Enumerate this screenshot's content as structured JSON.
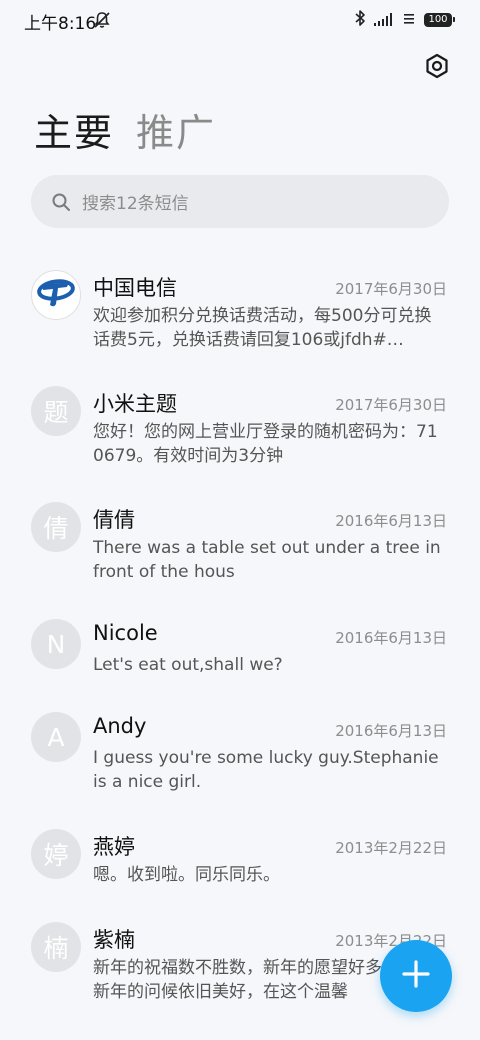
{
  "status_bar": {
    "time": "上午8:16",
    "battery": "100",
    "icons": [
      "mute-icon",
      "bluetooth-icon",
      "signal-icon",
      "wifi-icon",
      "battery-icon"
    ]
  },
  "header": {
    "settings_icon": "settings-hexagon-icon",
    "tabs": [
      {
        "label": "主要",
        "active": true
      },
      {
        "label": "推广",
        "active": false
      }
    ]
  },
  "search": {
    "placeholder": "搜索12条短信"
  },
  "messages": [
    {
      "name": "中国电信",
      "date": "2017年6月30日",
      "preview": "欢迎参加积分兑换话费活动，每500分可兑换话费5元，兑换话费请回复106或jfdh#…",
      "avatar": "",
      "avatar_type": "china-telecom-logo"
    },
    {
      "name": "小米主题",
      "date": "2017年6月30日",
      "preview": "您好！您的网上营业厅登录的随机密码为：710679。有效时间为3分钟",
      "avatar": "题",
      "avatar_type": "letter"
    },
    {
      "name": "倩倩",
      "date": "2016年6月13日",
      "preview": "There was a table set out under a tree in front of the hous",
      "avatar": "倩",
      "avatar_type": "letter"
    },
    {
      "name": "Nicole",
      "date": "2016年6月13日",
      "preview": "Let's eat out,shall we?",
      "avatar": "N",
      "avatar_type": "letter"
    },
    {
      "name": "Andy",
      "date": "2016年6月13日",
      "preview": "I guess you're some lucky guy.Stephanie is a nice girl.",
      "avatar": "A",
      "avatar_type": "letter"
    },
    {
      "name": "燕婷",
      "date": "2013年2月22日",
      "preview": "嗯。收到啦。同乐同乐。",
      "avatar": "婷",
      "avatar_type": "letter"
    },
    {
      "name": "紫楠",
      "date": "2013年2月22日",
      "preview": "新年的祝福数不胜数，新年的愿望好多好多，新年的问候依旧美好，在这个温馨",
      "avatar": "楠",
      "avatar_type": "letter"
    }
  ],
  "fab": {
    "icon": "plus-icon",
    "color": "#1aa3f0"
  },
  "colors": {
    "background": "#f6f7fa",
    "accent": "#1aa3f0",
    "avatar_bg": "#e2e3e7"
  }
}
